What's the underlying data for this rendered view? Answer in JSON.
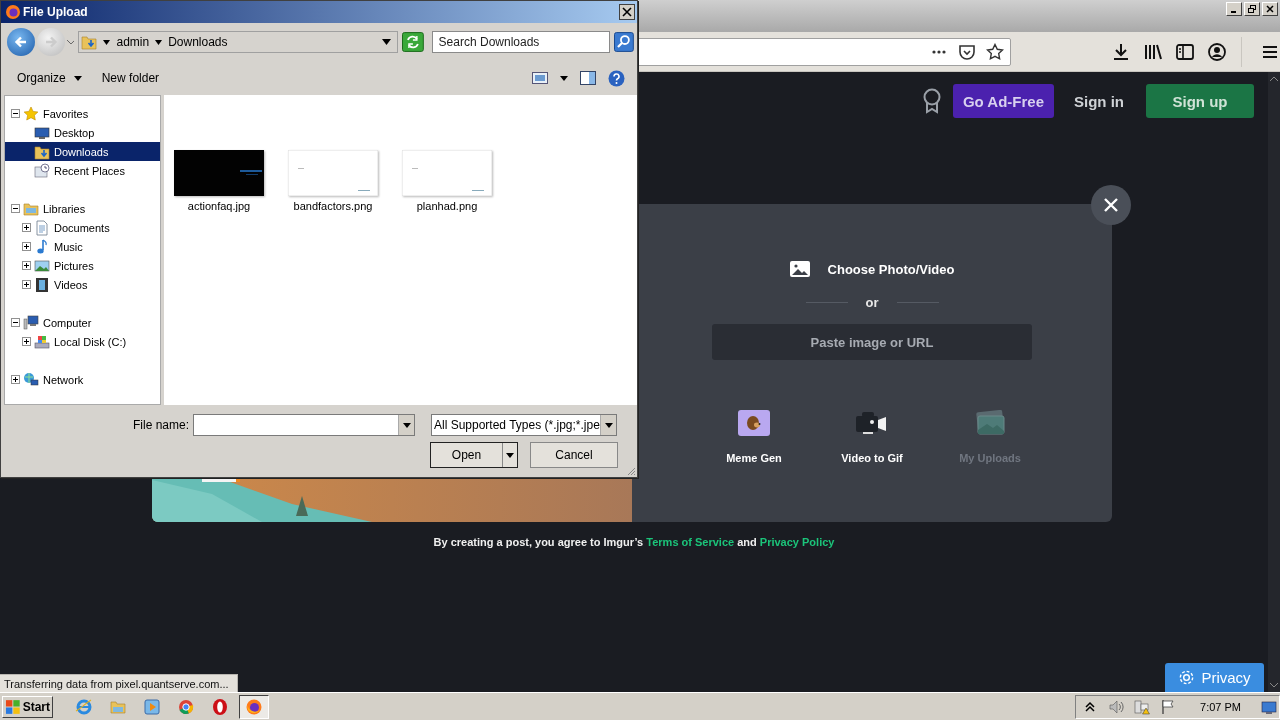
{
  "dialog": {
    "title": "File Upload",
    "breadcrumb": [
      "admin",
      "Downloads"
    ],
    "search": {
      "placeholder": "Search Downloads"
    },
    "toolbar": {
      "organize": "Organize",
      "new_folder": "New folder"
    },
    "tree": [
      {
        "kind": "favorites",
        "label": "Favorites",
        "expanded": true,
        "selected": false,
        "children": [
          {
            "kind": "desktop",
            "label": "Desktop",
            "selected": false
          },
          {
            "kind": "downloads",
            "label": "Downloads",
            "selected": true
          },
          {
            "kind": "recent",
            "label": "Recent Places",
            "selected": false
          }
        ]
      },
      {
        "kind": "libraries",
        "label": "Libraries",
        "expanded": true,
        "selected": false,
        "children": [
          {
            "kind": "documents",
            "label": "Documents",
            "expanded": false,
            "selected": false
          },
          {
            "kind": "music",
            "label": "Music",
            "expanded": false,
            "selected": false
          },
          {
            "kind": "pictures",
            "label": "Pictures",
            "expanded": false,
            "selected": false
          },
          {
            "kind": "videos",
            "label": "Videos",
            "expanded": false,
            "selected": false
          }
        ]
      },
      {
        "kind": "computer",
        "label": "Computer",
        "expanded": true,
        "selected": false,
        "children": [
          {
            "kind": "disk",
            "label": "Local Disk (C:)",
            "expanded": false,
            "selected": false
          }
        ]
      },
      {
        "kind": "network",
        "label": "Network",
        "expanded": false,
        "selected": false
      }
    ],
    "files": [
      {
        "name": "actionfaq.jpg",
        "kind": "dark"
      },
      {
        "name": "bandfactors.png",
        "kind": "light"
      },
      {
        "name": "planhad.png",
        "kind": "light"
      }
    ],
    "file_name": {
      "label": "File name:"
    },
    "file_type": {
      "value": "All Supported Types (*.jpg;*.jpe"
    },
    "buttons": {
      "open": "Open",
      "cancel": "Cancel"
    }
  },
  "page": {
    "header": {
      "go_ad_free": "Go Ad-Free",
      "sign_in": "Sign in",
      "sign_up": "Sign up"
    },
    "upload": {
      "choose": "Choose Photo/Video",
      "or": "or",
      "paste": {
        "placeholder": "Paste image or URL"
      },
      "tiles": [
        {
          "kind": "meme",
          "label": "Meme Gen",
          "disabled": false
        },
        {
          "kind": "video",
          "label": "Video to Gif",
          "disabled": false
        },
        {
          "kind": "uploads",
          "label": "My Uploads",
          "disabled": true
        }
      ]
    },
    "terms": {
      "text": "By creating a post, you agree to Imgur’s",
      "links": [
        "Terms of Service",
        "Privacy Policy"
      ],
      "joiner": "and"
    },
    "privacy_button": "Privacy"
  },
  "status_bar": "Transferring data from pixel.quantserve.com...",
  "taskbar": {
    "start": "Start",
    "apps": [
      {
        "kind": "ie",
        "selected": false
      },
      {
        "kind": "explorer",
        "selected": false
      },
      {
        "kind": "player",
        "selected": false
      },
      {
        "kind": "chrome",
        "selected": false
      },
      {
        "kind": "opera",
        "selected": false
      },
      {
        "kind": "firefox",
        "selected": true
      }
    ],
    "clock": "7:07 PM"
  }
}
